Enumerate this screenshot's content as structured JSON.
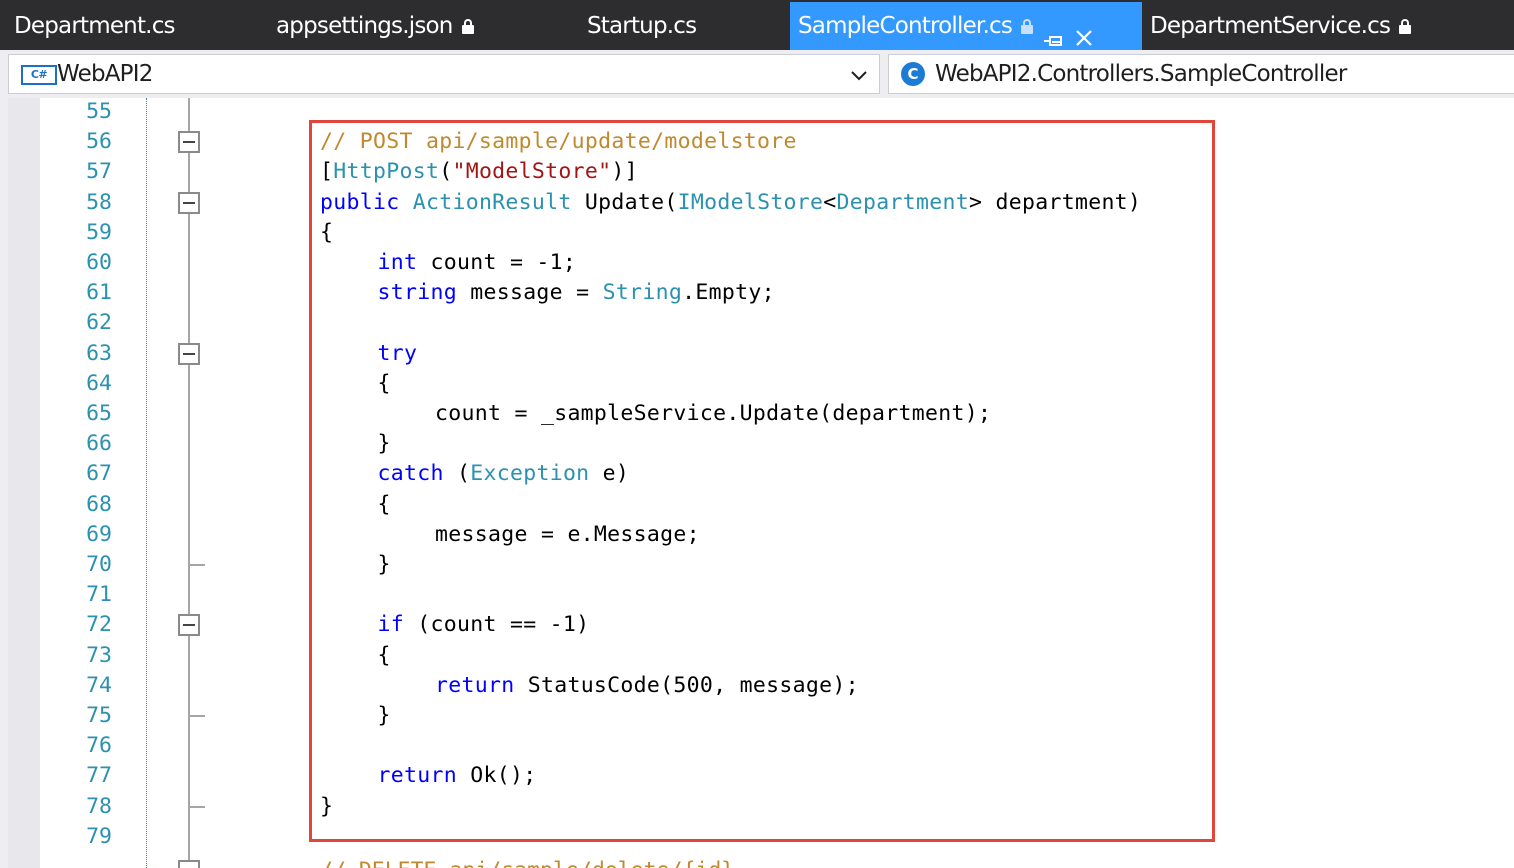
{
  "tabs": [
    {
      "label": "Department.cs",
      "locked": false,
      "active": false
    },
    {
      "label": "appsettings.json",
      "locked": true,
      "active": false
    },
    {
      "label": "Startup.cs",
      "locked": false,
      "active": false
    },
    {
      "label": "SampleController.cs",
      "locked": true,
      "active": true
    },
    {
      "label": "DepartmentService.cs",
      "locked": true,
      "active": false
    }
  ],
  "navbar": {
    "project_icon_text": "C#",
    "project": "WebAPI2",
    "class_icon_text": "C",
    "class": "WebAPI2.Controllers.SampleController"
  },
  "colors": {
    "tab_bar_bg": "#2d2d30",
    "active_tab_bg": "#3399ff",
    "line_number": "#2b91af",
    "keyword": "#0000ff",
    "type": "#2b91af",
    "string": "#a31515",
    "comment": "#c0892d",
    "highlight_border": "#e2453c"
  },
  "editor": {
    "lines": [
      {
        "no": "55",
        "indent": 0,
        "tokens": []
      },
      {
        "no": "56",
        "indent": 0,
        "tokens": [
          {
            "t": "// POST api/sample/update/modelstore",
            "k": "comment"
          }
        ]
      },
      {
        "no": "57",
        "indent": 0,
        "tokens": [
          {
            "t": "[",
            "k": "plain"
          },
          {
            "t": "HttpPost",
            "k": "type"
          },
          {
            "t": "(",
            "k": "plain"
          },
          {
            "t": "\"ModelStore\"",
            "k": "string"
          },
          {
            "t": ")]",
            "k": "plain"
          }
        ]
      },
      {
        "no": "58",
        "indent": 0,
        "tokens": [
          {
            "t": "public",
            "k": "keyword"
          },
          {
            "t": " ",
            "k": "plain"
          },
          {
            "t": "ActionResult",
            "k": "type"
          },
          {
            "t": " Update(",
            "k": "plain"
          },
          {
            "t": "IModelStore",
            "k": "type"
          },
          {
            "t": "<",
            "k": "plain"
          },
          {
            "t": "Department",
            "k": "type"
          },
          {
            "t": "> department)",
            "k": "plain"
          }
        ]
      },
      {
        "no": "59",
        "indent": 0,
        "tokens": [
          {
            "t": "{",
            "k": "plain"
          }
        ]
      },
      {
        "no": "60",
        "indent": 1,
        "tokens": [
          {
            "t": "int",
            "k": "keyword"
          },
          {
            "t": " count = -1;",
            "k": "plain"
          }
        ]
      },
      {
        "no": "61",
        "indent": 1,
        "tokens": [
          {
            "t": "string",
            "k": "keyword"
          },
          {
            "t": " message = ",
            "k": "plain"
          },
          {
            "t": "String",
            "k": "type"
          },
          {
            "t": ".Empty;",
            "k": "plain"
          }
        ]
      },
      {
        "no": "62",
        "indent": 0,
        "tokens": []
      },
      {
        "no": "63",
        "indent": 1,
        "tokens": [
          {
            "t": "try",
            "k": "keyword"
          }
        ]
      },
      {
        "no": "64",
        "indent": 1,
        "tokens": [
          {
            "t": "{",
            "k": "plain"
          }
        ]
      },
      {
        "no": "65",
        "indent": 2,
        "tokens": [
          {
            "t": "count = _sampleService.Update(department);",
            "k": "plain"
          }
        ]
      },
      {
        "no": "66",
        "indent": 1,
        "tokens": [
          {
            "t": "}",
            "k": "plain"
          }
        ]
      },
      {
        "no": "67",
        "indent": 1,
        "tokens": [
          {
            "t": "catch",
            "k": "keyword"
          },
          {
            "t": " (",
            "k": "plain"
          },
          {
            "t": "Exception",
            "k": "type"
          },
          {
            "t": " e)",
            "k": "plain"
          }
        ]
      },
      {
        "no": "68",
        "indent": 1,
        "tokens": [
          {
            "t": "{",
            "k": "plain"
          }
        ]
      },
      {
        "no": "69",
        "indent": 2,
        "tokens": [
          {
            "t": "message = e.Message;",
            "k": "plain"
          }
        ]
      },
      {
        "no": "70",
        "indent": 1,
        "tokens": [
          {
            "t": "}",
            "k": "plain"
          }
        ]
      },
      {
        "no": "71",
        "indent": 0,
        "tokens": []
      },
      {
        "no": "72",
        "indent": 1,
        "tokens": [
          {
            "t": "if",
            "k": "keyword"
          },
          {
            "t": " (count == -1)",
            "k": "plain"
          }
        ]
      },
      {
        "no": "73",
        "indent": 1,
        "tokens": [
          {
            "t": "{",
            "k": "plain"
          }
        ]
      },
      {
        "no": "74",
        "indent": 2,
        "tokens": [
          {
            "t": "return",
            "k": "keyword"
          },
          {
            "t": " StatusCode(500, message);",
            "k": "plain"
          }
        ]
      },
      {
        "no": "75",
        "indent": 1,
        "tokens": [
          {
            "t": "}",
            "k": "plain"
          }
        ]
      },
      {
        "no": "76",
        "indent": 0,
        "tokens": []
      },
      {
        "no": "77",
        "indent": 1,
        "tokens": [
          {
            "t": "return",
            "k": "keyword"
          },
          {
            "t": " Ok();",
            "k": "plain"
          }
        ]
      },
      {
        "no": "78",
        "indent": 0,
        "tokens": [
          {
            "t": "}",
            "k": "plain"
          }
        ]
      },
      {
        "no": "79",
        "indent": 0,
        "tokens": []
      }
    ],
    "cut_off_comment": "// DELETE api/sample/delete/{id}",
    "fold_boxes": [
      "56",
      "58",
      "63",
      "72"
    ],
    "fold_ends": [
      "70",
      "75",
      "78"
    ]
  }
}
